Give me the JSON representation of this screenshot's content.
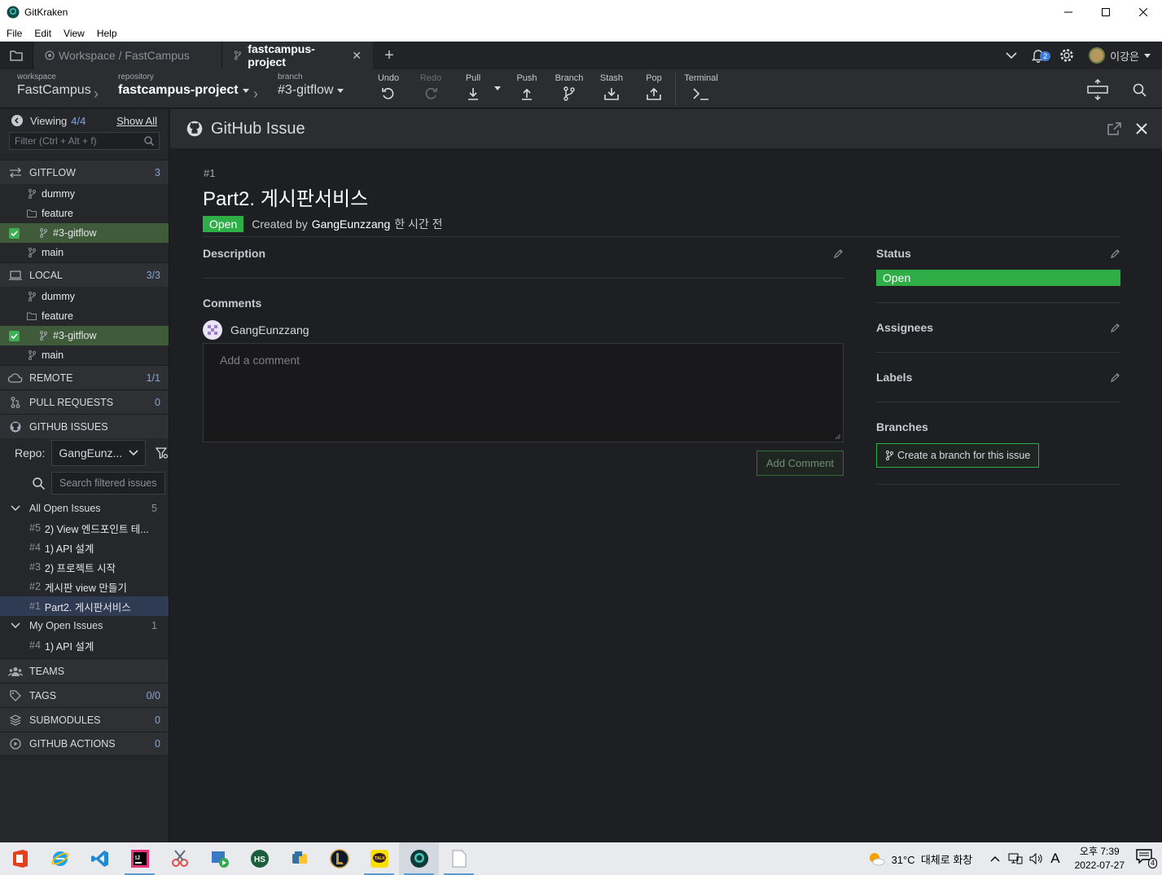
{
  "window": {
    "title": "GitKraken"
  },
  "menu": [
    "File",
    "Edit",
    "View",
    "Help"
  ],
  "tabs": {
    "workspace": "Workspace / FastCampus",
    "active": "fastcampus-project",
    "notifications": "2",
    "user": "이강은"
  },
  "toolbar": {
    "workspace_label": "workspace",
    "workspace_value": "FastCampus",
    "repository_label": "repository",
    "repository_value": "fastcampus-project",
    "branch_label": "branch",
    "branch_value": "#3-gitflow",
    "undo": "Undo",
    "redo": "Redo",
    "pull": "Pull",
    "push": "Push",
    "branch": "Branch",
    "stash": "Stash",
    "pop": "Pop",
    "terminal": "Terminal"
  },
  "sidebar": {
    "viewing_label": "Viewing",
    "viewing_count": "4/4",
    "show_all": "Show All",
    "filter_placeholder": "Filter (Ctrl + Alt + f)",
    "gitflow": {
      "label": "GITFLOW",
      "count": "3",
      "items": [
        "dummy",
        "feature",
        "#3-gitflow",
        "main"
      ]
    },
    "local": {
      "label": "LOCAL",
      "count": "3/3",
      "items": [
        "dummy",
        "feature",
        "#3-gitflow",
        "main"
      ]
    },
    "remote": {
      "label": "REMOTE",
      "count": "1/1"
    },
    "pull_requests": {
      "label": "PULL REQUESTS",
      "count": "0"
    },
    "github_issues": {
      "label": "GITHUB ISSUES"
    },
    "repo_label": "Repo:",
    "repo_value": "GangEunz...",
    "issue_search_placeholder": "Search filtered issues",
    "all_open": {
      "label": "All Open Issues",
      "count": "5",
      "issues": [
        {
          "num": "#5",
          "title": "2) View 엔드포인트 테..."
        },
        {
          "num": "#4",
          "title": "1) API 설계"
        },
        {
          "num": "#3",
          "title": "2) 프로젝트 시작"
        },
        {
          "num": "#2",
          "title": "게시판 view 만들기"
        },
        {
          "num": "#1",
          "title": "Part2. 게시판서비스"
        }
      ]
    },
    "my_open": {
      "label": "My Open Issues",
      "count": "1",
      "issues": [
        {
          "num": "#4",
          "title": "1) API 설계"
        }
      ]
    },
    "teams": {
      "label": "TEAMS"
    },
    "tags": {
      "label": "TAGS",
      "count": "0/0"
    },
    "submodules": {
      "label": "SUBMODULES",
      "count": "0"
    },
    "github_actions": {
      "label": "GITHUB ACTIONS",
      "count": "0"
    }
  },
  "issue": {
    "panel_title": "GitHub Issue",
    "number": "#1",
    "title": "Part2. 게시판서비스",
    "state": "Open",
    "created_by_label": "Created by",
    "author": "GangEunzzang",
    "time_ago": "한 시간 전",
    "description_label": "Description",
    "comments_label": "Comments",
    "commenter": "GangEunzzang",
    "comment_placeholder": "Add a comment",
    "add_comment_button": "Add Comment",
    "status_label": "Status",
    "status_value": "Open",
    "assignees_label": "Assignees",
    "labels_label": "Labels",
    "branches_label": "Branches",
    "create_branch_button": "Create a branch for this issue"
  },
  "taskbar": {
    "weather": "31°C  대체로 화창",
    "ime": "A",
    "time": "오후 7:39",
    "date": "2022-07-27",
    "notif_count": "4"
  },
  "colors": {
    "accent_green": "#2fae48",
    "selection_blue": "#2f3b52",
    "link_blue": "#7ea6e0"
  }
}
